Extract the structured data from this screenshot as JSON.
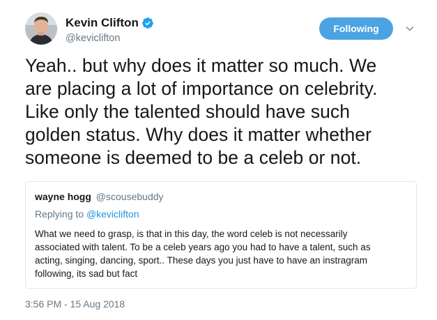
{
  "author": {
    "display_name": "Kevin Clifton",
    "handle": "@keviclifton",
    "verified": true
  },
  "follow_button": {
    "label": "Following",
    "color": "#4ba3e3"
  },
  "tweet": {
    "lines": [
      "Yeah.. but why does it matter so much. We",
      "are placing a lot of importance on celebrity.",
      "Like only the talented should have such",
      "golden status. Why does it matter whether",
      "someone is deemed to be a celeb or not."
    ],
    "timestamp": "3:56 PM - 15 Aug 2018"
  },
  "quoted_tweet": {
    "display_name": "wayne hogg",
    "handle": "@scousebuddy",
    "replying_prefix": "Replying to ",
    "replying_to": "@keviclifton",
    "lines": [
      "What we need to grasp, is that in this day, the word celeb is not necessarily",
      "associated with talent. To be a celeb years ago you had to have a talent, such as",
      "acting, singing, dancing, sport.. These days you just have to have an instragram",
      "following, its sad but fact"
    ]
  },
  "icons": {
    "verified": "verified-badge-icon",
    "menu": "chevron-down-icon"
  },
  "colors": {
    "link": "#1b95e0",
    "secondary_text": "#657786",
    "border": "#e1e8ed"
  }
}
